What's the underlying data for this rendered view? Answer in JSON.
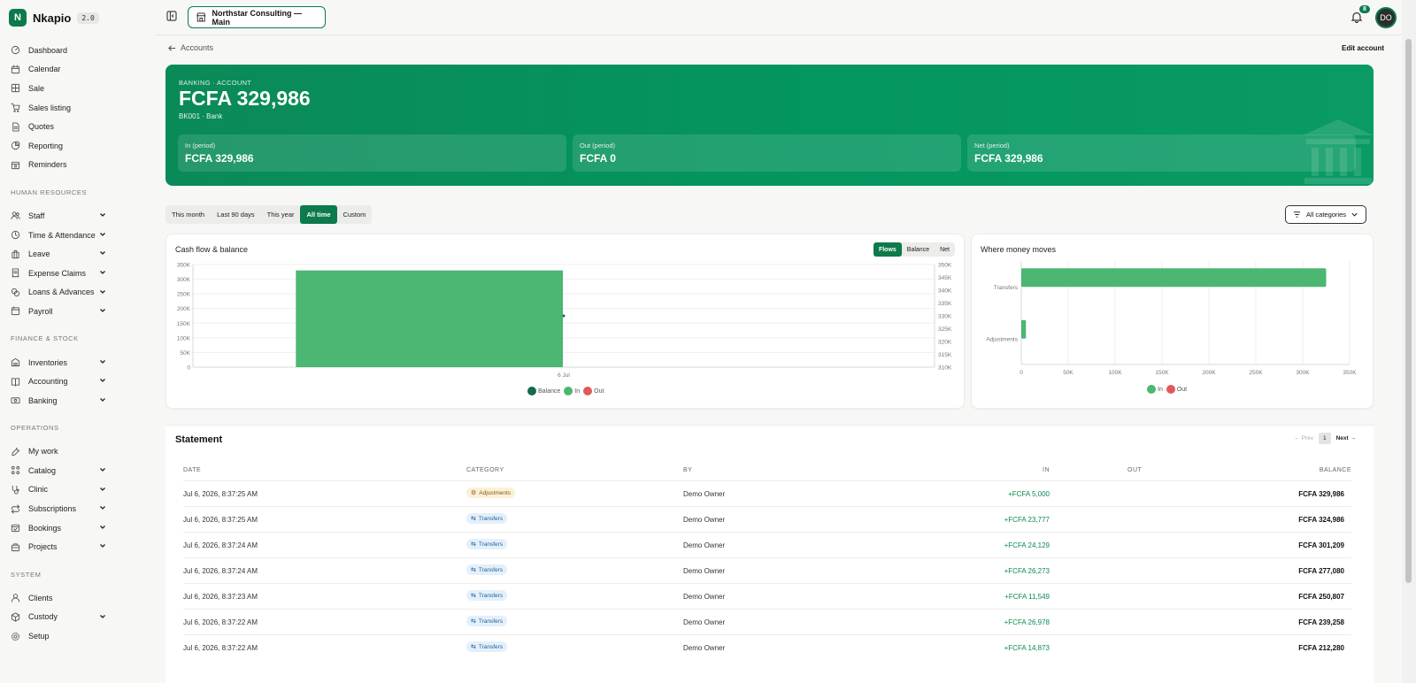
{
  "brand": {
    "logo_letter": "N",
    "name": "Nkapio",
    "version": "2.0"
  },
  "nav": {
    "main": [
      "Dashboard",
      "Calendar",
      "Sale",
      "Sales listing",
      "Quotes",
      "Reporting",
      "Reminders"
    ],
    "sections": [
      {
        "title": "HUMAN RESOURCES",
        "items": [
          "Staff",
          "Time & Attendance",
          "Leave",
          "Expense Claims",
          "Loans & Advances",
          "Payroll"
        ]
      },
      {
        "title": "FINANCE & STOCK",
        "items": [
          "Inventories",
          "Accounting",
          "Banking"
        ]
      },
      {
        "title": "OPERATIONS",
        "items": [
          "My work",
          "Catalog",
          "Clinic",
          "Subscriptions",
          "Bookings",
          "Projects"
        ]
      },
      {
        "title": "SYSTEM",
        "items": [
          "Clients",
          "Custody",
          "Setup"
        ]
      }
    ]
  },
  "topbar": {
    "org_name": "Northstar Consulting — Main",
    "notifications": "8",
    "avatar_initials": "DO"
  },
  "page": {
    "breadcrumb": "Accounts",
    "edit_label": "Edit account",
    "kicker": "BANKING · ACCOUNT",
    "balance": "FCFA 329,986",
    "sub": "BK001 · Bank",
    "stats": [
      {
        "label": "In (period)",
        "value": "FCFA 329,986"
      },
      {
        "label": "Out (period)",
        "value": "FCFA 0"
      },
      {
        "label": "Net (period)",
        "value": "FCFA 329,986"
      }
    ],
    "ranges": [
      "This month",
      "Last 90 days",
      "This year",
      "All time",
      "Custom"
    ],
    "active_range": "All time",
    "category_filter": "All categories"
  },
  "cashflow": {
    "title": "Cash flow & balance",
    "modes": [
      "Flows",
      "Balance",
      "Net"
    ],
    "active_mode": "Flows",
    "legend": [
      "Balance",
      "In",
      "Out"
    ]
  },
  "moves": {
    "title": "Where money moves",
    "legend": [
      "In",
      "Out"
    ]
  },
  "chart_data": [
    {
      "type": "bar",
      "title": "Cash flow & balance",
      "categories": [
        "6 Jul"
      ],
      "series": [
        {
          "name": "In",
          "values": [
            329986
          ]
        },
        {
          "name": "Out",
          "values": [
            0
          ]
        },
        {
          "name": "Balance",
          "values": [
            329986
          ]
        }
      ],
      "ylim": [
        0,
        350000
      ],
      "yticks": [
        "350K",
        "300K",
        "250K",
        "200K",
        "150K",
        "100K",
        "50K",
        "0"
      ],
      "y2lim": [
        310000,
        350000
      ],
      "y2ticks": [
        "350K",
        "345K",
        "340K",
        "335K",
        "330K",
        "325K",
        "320K",
        "315K",
        "310K"
      ],
      "grid": true,
      "legend_position": "bottom"
    },
    {
      "type": "bar",
      "orientation": "horizontal",
      "title": "Where money moves",
      "categories": [
        "Transfers",
        "Adjustments"
      ],
      "series": [
        {
          "name": "In",
          "values": [
            324986,
            5000
          ]
        },
        {
          "name": "Out",
          "values": [
            0,
            0
          ]
        }
      ],
      "xlim": [
        0,
        350000
      ],
      "xticks": [
        "0",
        "50K",
        "100K",
        "150K",
        "200K",
        "250K",
        "300K",
        "350K"
      ],
      "grid": true,
      "legend_position": "bottom"
    }
  ],
  "statement": {
    "title": "Statement",
    "pager": {
      "prev": "← Prev",
      "page": "1",
      "next": "Next →"
    },
    "columns": [
      "DATE",
      "CATEGORY",
      "BY",
      "IN",
      "OUT",
      "BALANCE"
    ],
    "rows": [
      {
        "date": "Jul 6, 2026, 8:37:25 AM",
        "category": "Adjustments",
        "by": "Demo Owner",
        "in": "+FCFA 5,000",
        "out": "",
        "balance": "FCFA 329,986"
      },
      {
        "date": "Jul 6, 2026, 8:37:25 AM",
        "category": "Transfers",
        "by": "Demo Owner",
        "in": "+FCFA 23,777",
        "out": "",
        "balance": "FCFA 324,986"
      },
      {
        "date": "Jul 6, 2026, 8:37:24 AM",
        "category": "Transfers",
        "by": "Demo Owner",
        "in": "+FCFA 24,129",
        "out": "",
        "balance": "FCFA 301,209"
      },
      {
        "date": "Jul 6, 2026, 8:37:24 AM",
        "category": "Transfers",
        "by": "Demo Owner",
        "in": "+FCFA 26,273",
        "out": "",
        "balance": "FCFA 277,080"
      },
      {
        "date": "Jul 6, 2026, 8:37:23 AM",
        "category": "Transfers",
        "by": "Demo Owner",
        "in": "+FCFA 11,549",
        "out": "",
        "balance": "FCFA 250,807"
      },
      {
        "date": "Jul 6, 2026, 8:37:22 AM",
        "category": "Transfers",
        "by": "Demo Owner",
        "in": "+FCFA 26,978",
        "out": "",
        "balance": "FCFA 239,258"
      },
      {
        "date": "Jul 6, 2026, 8:37:22 AM",
        "category": "Transfers",
        "by": "Demo Owner",
        "in": "+FCFA 14,873",
        "out": "",
        "balance": "FCFA 212,280"
      }
    ]
  },
  "colors": {
    "brand": "#0c7a4b",
    "in": "#4cb673",
    "out": "#e05a5a",
    "balance": "#136b4e"
  }
}
